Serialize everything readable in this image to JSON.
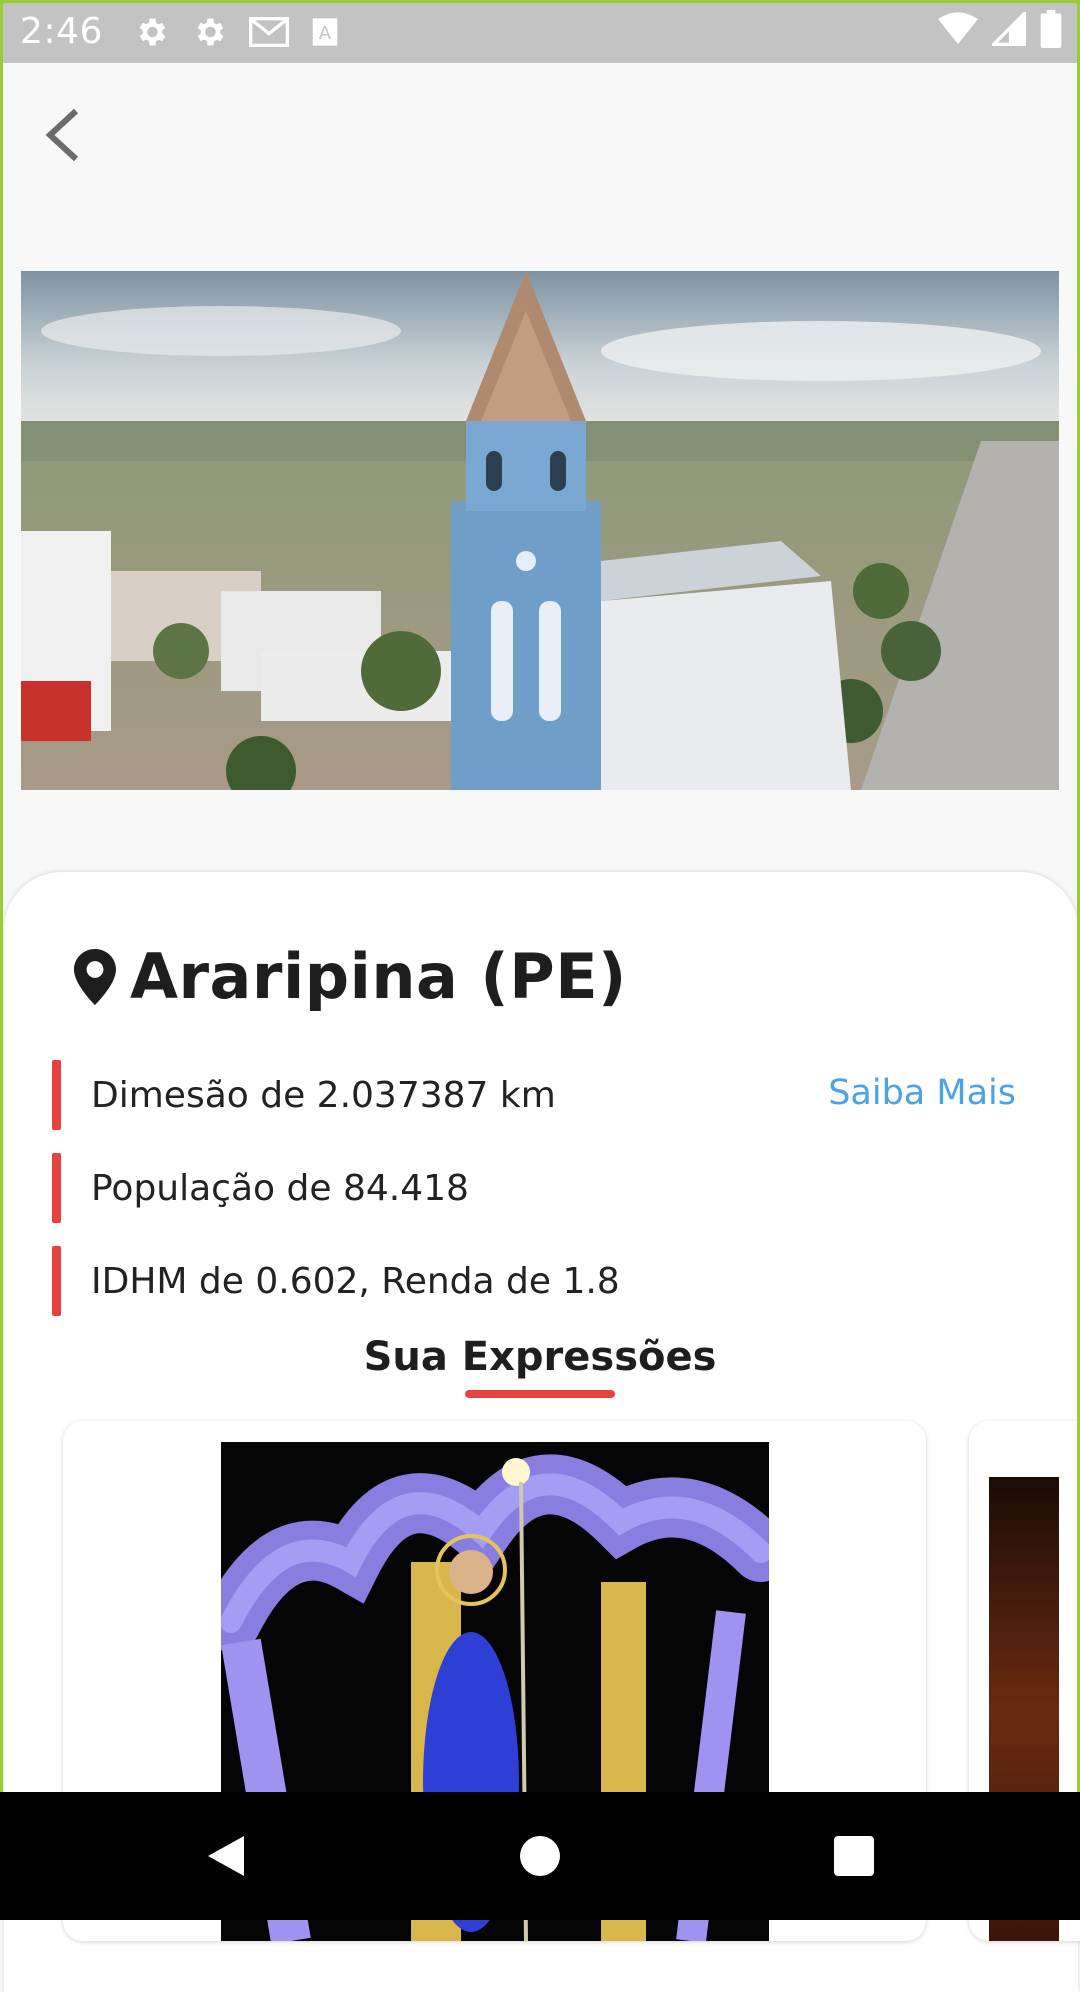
{
  "status_bar": {
    "time": "2:46",
    "icons": [
      "settings-icon",
      "settings-icon",
      "gmail-icon",
      "font-icon",
      "wifi-icon",
      "signal-icon",
      "battery-icon"
    ]
  },
  "header": {
    "back_icon": "chevron-left-icon"
  },
  "city": {
    "name": "Araripina (PE)",
    "pin_icon": "location-pin-icon",
    "facts": [
      "Dimesão de 2.037387 km",
      "População de 84.418",
      "IDHM de 0.602, Renda de 1.8"
    ],
    "more_link": "Saiba Mais"
  },
  "expressions": {
    "title": "Sua Expressões"
  },
  "colors": {
    "accent": "#e8423e",
    "link": "#4aa3e6",
    "status_bar": "#c3c3c3"
  },
  "nav": {
    "back": "back-triangle-icon",
    "home": "home-circle-icon",
    "recents": "recents-square-icon"
  }
}
